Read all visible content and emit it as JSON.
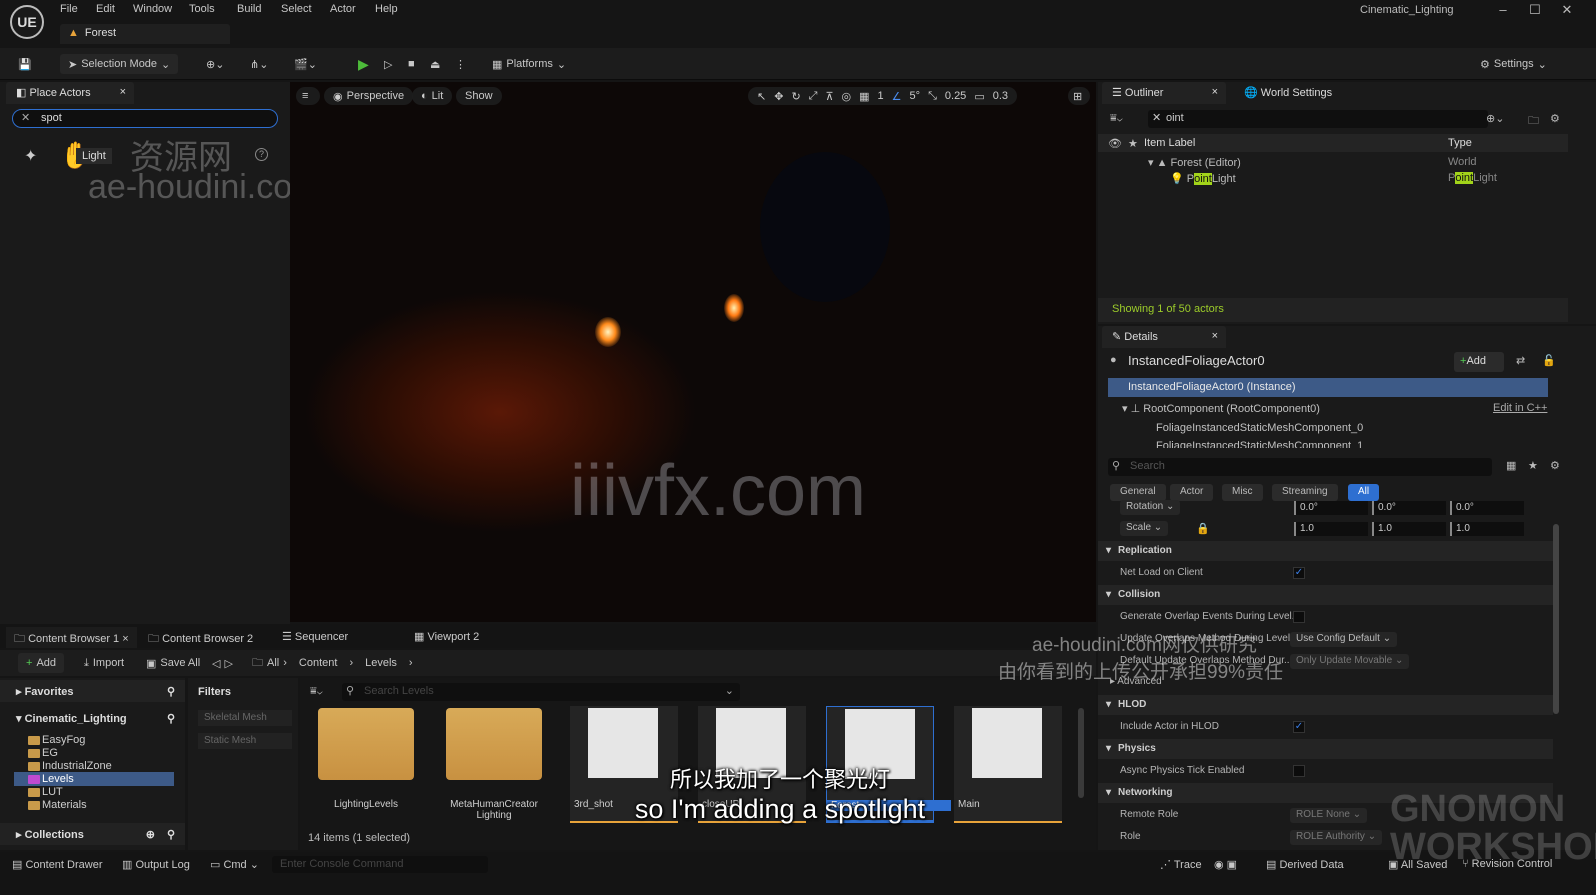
{
  "app": {
    "title": "Cinematic_Lighting",
    "logo": "UE"
  },
  "menu": [
    "File",
    "Edit",
    "Window",
    "Tools",
    "Build",
    "Select",
    "Actor",
    "Help"
  ],
  "document_tab": "Forest",
  "toolbar": {
    "selection_mode": "Selection Mode",
    "platforms": "Platforms",
    "settings": "Settings"
  },
  "place_actors": {
    "tab": "Place Actors",
    "search_value": "spot",
    "result_label": "Light"
  },
  "viewport": {
    "perspective": "Perspective",
    "lit": "Lit",
    "show": "Show",
    "grid": "1",
    "angle": "5°",
    "scale": "0.25",
    "camera_speed": "0.3"
  },
  "outliner": {
    "tab": "Outliner",
    "world_settings_tab": "World Settings",
    "search_value": "oint",
    "col_label": "Item Label",
    "col_type": "Type",
    "rows": [
      {
        "label": "Forest (Editor)",
        "type": "World"
      },
      {
        "label_pre": "P",
        "label_hl": "oint",
        "label_post": "Light",
        "type_pre": "P",
        "type_hl": "oint",
        "type_post": "Light"
      }
    ],
    "status": "Showing 1 of 50 actors"
  },
  "details": {
    "tab": "Details",
    "actor": "InstancedFoliageActor0",
    "add": "Add",
    "instance": "InstancedFoliageActor0 (Instance)",
    "root": "RootComponent (RootComponent0)",
    "edit_cpp": "Edit in C++",
    "comp0": "FoliageInstancedStaticMeshComponent_0",
    "comp1": "FoliageInstancedStaticMeshComponent_1",
    "search_placeholder": "Search",
    "categories": [
      "General",
      "Actor",
      "Misc",
      "Streaming",
      "All"
    ],
    "rotation_label": "Rotation",
    "rotation": [
      "0.0°",
      "0.0°",
      "0.0°"
    ],
    "scale_label": "Scale",
    "scale": [
      "1.0",
      "1.0",
      "1.0"
    ],
    "sections": {
      "replication": "Replication",
      "net_load": "Net Load on Client",
      "collision": "Collision",
      "gen_overlap": "Generate Overlap Events During Level...",
      "update_overlaps": "Update Overlaps Method During Level...",
      "use_config": "Use Config Default",
      "default_overlap": "Default Update Overlaps Method Dur...",
      "only_movable": "Only Update Movable",
      "advanced": "Advanced",
      "hlod": "HLOD",
      "include_hlod": "Include Actor in HLOD",
      "physics": "Physics",
      "async_tick": "Async Physics Tick Enabled",
      "networking": "Networking",
      "remote_role": "Remote Role",
      "role_none": "ROLE None",
      "role": "Role",
      "role_authority": "ROLE Authority"
    }
  },
  "content_browser": {
    "tabs": [
      "Content Browser 1",
      "Content Browser 2",
      "Sequencer",
      "Viewport 2"
    ],
    "add": "Add",
    "import": "Import",
    "save_all": "Save All",
    "path": [
      "All",
      "Content",
      "Levels"
    ],
    "favorites": "Favorites",
    "root": "Cinematic_Lighting",
    "tree": [
      "EasyFog",
      "EG",
      "IndustrialZone",
      "Levels",
      "LUT",
      "Materials"
    ],
    "collections": "Collections",
    "filters": "Filters",
    "filter_items": [
      "Skeletal Mesh",
      "Static Mesh"
    ],
    "search_placeholder": "Search Levels",
    "assets": [
      "LightingLevels",
      "MetaHumanCreator Lighting",
      "3rd_shot",
      "closeUP",
      "Forest",
      "Main"
    ],
    "count": "14 items (1 selected)"
  },
  "statusbar": {
    "drawer": "Content Drawer",
    "output": "Output Log",
    "cmd": "Cmd",
    "console_placeholder": "Enter Console Command",
    "trace": "Trace",
    "derived": "Derived Data",
    "saved": "All Saved",
    "revision": "Revision Control"
  },
  "subtitles": {
    "zh": "所以我加了一个聚光灯",
    "en": "so I'm adding a spotlight"
  },
  "watermarks": {
    "wm1": "资源网",
    "wm2": "ae-houdini.com",
    "wm3": "iiivfx.com",
    "wm4": "ae-houdini.com网仅供研究",
    "wm5": "由你看到的上传公开承担99%责任",
    "wm6": "GNOMON WORKSHOP"
  }
}
